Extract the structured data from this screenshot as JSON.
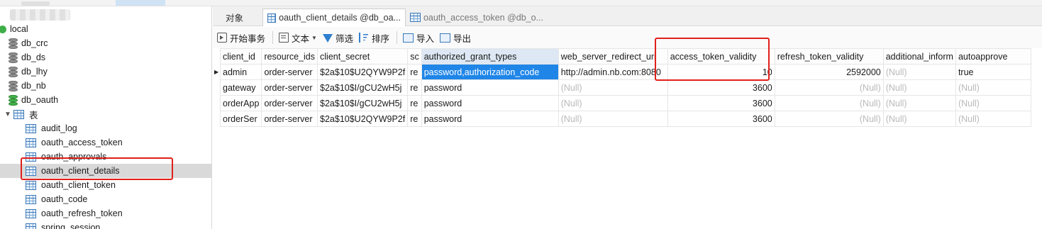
{
  "sidebar": {
    "connection": "local",
    "databases": [
      "db_crc",
      "db_ds",
      "db_lhy",
      "db_nb"
    ],
    "active_db": "db_oauth",
    "tables_folder": "表",
    "tables": [
      "audit_log",
      "oauth_access_token",
      "oauth_approvals",
      "oauth_client_details",
      "oauth_client_token",
      "oauth_code",
      "oauth_refresh_token",
      "spring_session"
    ],
    "selected_table": "oauth_client_details"
  },
  "tabs": [
    {
      "label": "对象"
    },
    {
      "label": "oauth_client_details @db_oa..."
    },
    {
      "label": "oauth_access_token @db_o..."
    }
  ],
  "toolbar": {
    "begin_transaction": "开始事务",
    "text": "文本",
    "filter": "筛选",
    "sort": "排序",
    "import": "导入",
    "export": "导出"
  },
  "grid": {
    "columns": [
      "client_id",
      "resource_ids",
      "client_secret",
      "sc",
      "authorized_grant_types",
      "web_server_redirect_uri",
      "access_token_validity",
      "refresh_token_validity",
      "additional_inform",
      "autoapprove"
    ],
    "rows": [
      [
        "admin",
        "order-server",
        "$2a$10$U2QYW9P2f",
        "re",
        "password,authorization_code",
        "http://admin.nb.com:8080",
        "10",
        "2592000",
        "(Null)",
        "true"
      ],
      [
        "gateway",
        "order-server",
        "$2a$10$I/gCU2wH5j",
        "re",
        "password",
        "(Null)",
        "3600",
        "(Null)",
        "(Null)",
        "(Null)"
      ],
      [
        "orderApp",
        "order-server",
        "$2a$10$I/gCU2wH5j",
        "re",
        "password",
        "(Null)",
        "3600",
        "(Null)",
        "(Null)",
        "(Null)"
      ],
      [
        "orderSer",
        "order-server",
        "$2a$10$U2QYW9P2f",
        "re",
        "password",
        "(Null)",
        "3600",
        "(Null)",
        "(Null)",
        "(Null)"
      ]
    ]
  },
  "colors": {
    "highlight_box": "#e0201b",
    "selected_cell": "#1f86e8",
    "null_text": "#b9b9b9"
  }
}
